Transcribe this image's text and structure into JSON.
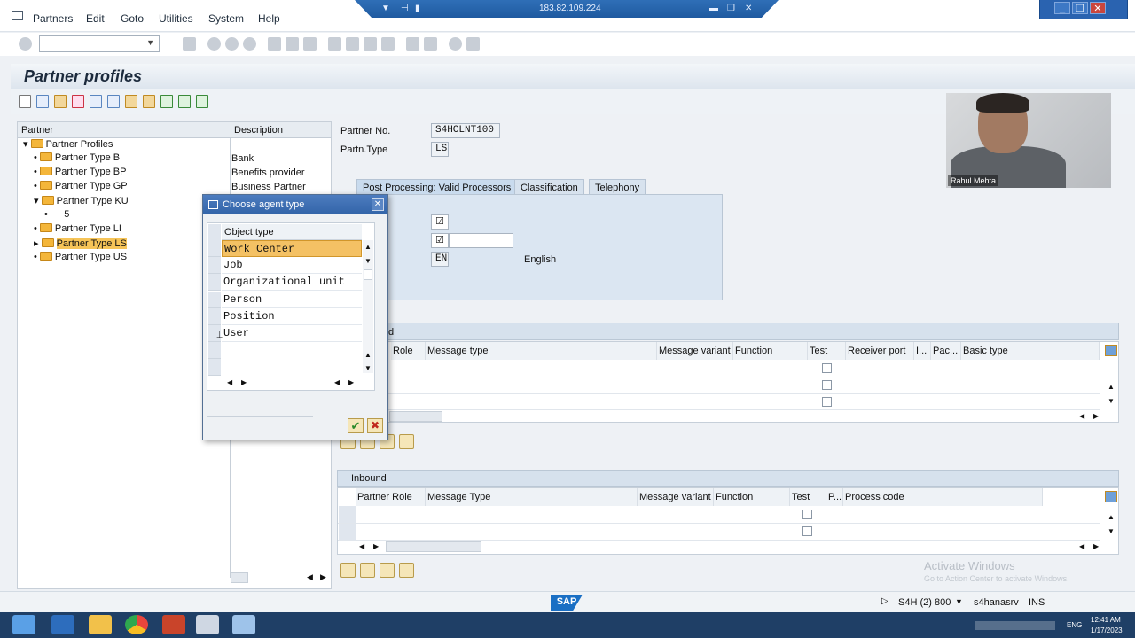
{
  "menu": [
    "Partners",
    "Edit",
    "Goto",
    "Utilities",
    "System",
    "Help"
  ],
  "rdp_ip": "183.82.109.224",
  "page_title": "Partner profiles",
  "tree": {
    "headers": [
      "Partner",
      "Description"
    ],
    "root": "Partner Profiles",
    "items": [
      {
        "label": "Partner Type B",
        "desc": "Bank"
      },
      {
        "label": "Partner Type BP",
        "desc": "Benefits provider"
      },
      {
        "label": "Partner Type GP",
        "desc": "Business Partner"
      },
      {
        "label": "Partner Type KU",
        "desc": ""
      },
      {
        "label": "5",
        "desc": ""
      },
      {
        "label": "Partner Type LI",
        "desc": ""
      },
      {
        "label": "Partner Type LS",
        "desc": ""
      },
      {
        "label": "Partner Type US",
        "desc": ""
      }
    ]
  },
  "partner": {
    "no_label": "Partner No.",
    "no_value": "S4HCLNT100",
    "type_label": "Partn.Type",
    "type_value": "LS"
  },
  "tabs": [
    "Post Processing: Valid Processors",
    "Classification",
    "Telephony"
  ],
  "fields": {
    "lang_code": "EN",
    "lang_name": "English",
    "check": "☑"
  },
  "outbound": {
    "title_fragment": "d",
    "columns": [
      "Role",
      "Message type",
      "Message variant",
      "Function",
      "Test",
      "Receiver port",
      "I...",
      "Pac...",
      "Basic type"
    ]
  },
  "inbound": {
    "title": "Inbound",
    "columns": [
      "Partner Role",
      "Message Type",
      "Message variant",
      "Function",
      "Test",
      "P...",
      "Process code"
    ]
  },
  "dialog": {
    "title": "Choose agent type",
    "column": "Object type",
    "rows": [
      "Work Center",
      "Job",
      "Organizational unit",
      "Person",
      "Position",
      "User"
    ]
  },
  "status": {
    "system": "S4H (2) 800",
    "server": "s4hanasrv",
    "mode": "INS",
    "logo": "SAP"
  },
  "watermark": {
    "line1": "Activate Windows",
    "line2": "Go to Action Center to activate Windows."
  },
  "webcam_name": "Rahul Mehta",
  "taskbar": {
    "lang": "ENG",
    "time": "12:41 AM",
    "date": "1/17/2023"
  }
}
